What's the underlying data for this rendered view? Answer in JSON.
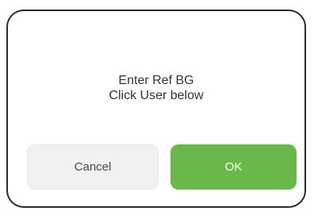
{
  "dialog": {
    "message_line1": "Enter Ref BG",
    "message_line2": "Click User below",
    "cancel_label": "Cancel",
    "ok_label": "OK"
  },
  "colors": {
    "ok_button": "#6bb84a",
    "cancel_button": "#f0f2f2",
    "border": "#2b2b2b"
  }
}
